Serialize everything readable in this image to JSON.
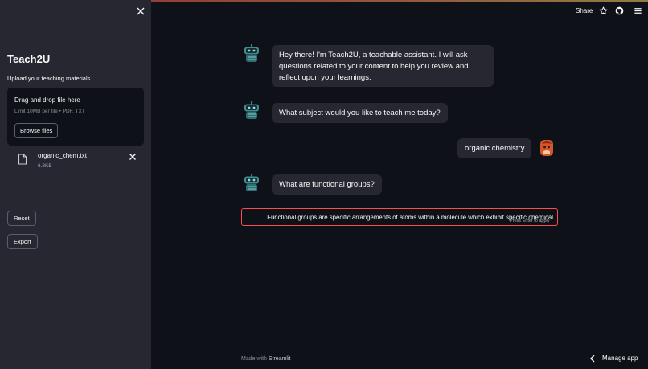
{
  "sidebar": {
    "title": "Teach2U",
    "upload_label": "Upload your teaching materials",
    "dropzone": {
      "title": "Drag and drop file here",
      "limit": "Limit 10MB per file • PDF, TXT",
      "browse_label": "Browse files"
    },
    "file": {
      "name": "organic_chem.txt",
      "size": "6.3KB"
    },
    "reset_label": "Reset",
    "export_label": "Export"
  },
  "header": {
    "share_label": "Share"
  },
  "chat": {
    "messages": [
      {
        "role": "assistant",
        "text": "Hey there! I'm Teach2U, a teachable assistant. I will ask questions related to your content to help you review and reflect upon your learnings."
      },
      {
        "role": "assistant",
        "text": "What subject would you like to teach me today?"
      },
      {
        "role": "user",
        "text": "organic chemistry"
      },
      {
        "role": "assistant",
        "text": "What are functional groups?"
      }
    ],
    "input_value": "Functional groups are specific arrangements of atoms within a molecule which exhibit specific chemical",
    "input_hint": "Press Enter to apply"
  },
  "footer": {
    "made_with": "Made with",
    "brand": "Streamlit",
    "manage_label": "Manage app"
  },
  "colors": {
    "background": "#0e1117",
    "sidebar": "#262730",
    "accent": "#ff4b4b",
    "bubble": "#262730"
  }
}
